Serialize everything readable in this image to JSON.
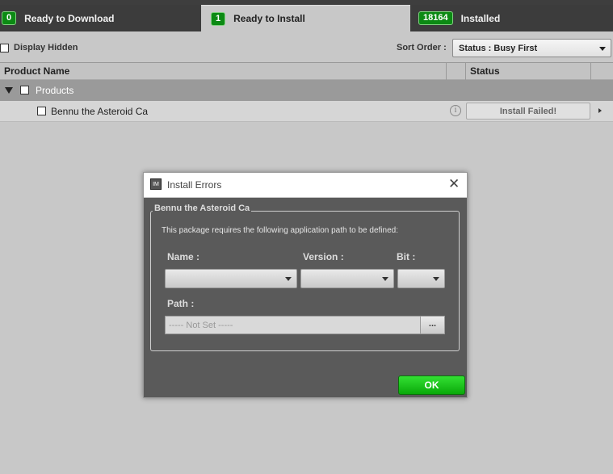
{
  "tabs": [
    {
      "count": "0",
      "label": "Ready to Download"
    },
    {
      "count": "1",
      "label": "Ready to Install"
    },
    {
      "count": "18164",
      "label": "Installed"
    }
  ],
  "toolbar": {
    "display_hidden_label": "Display Hidden",
    "sort_order_label": "Sort Order :",
    "sort_order_value": "Status : Busy First"
  },
  "grid": {
    "col_product": "Product Name",
    "col_status": "Status",
    "group_label": "Products",
    "item": {
      "name": "Bennu the Asteroid Ca",
      "status": "Install Failed!"
    }
  },
  "dialog": {
    "title": "Install Errors",
    "group_title": "Bennu the Asteroid Ca",
    "message": "This package requires the following application path to be defined:",
    "name_label": "Name :",
    "version_label": "Version :",
    "bit_label": "Bit :",
    "path_label": "Path :",
    "path_placeholder": "----- Not Set -----",
    "browse_label": "...",
    "ok_label": "OK",
    "app_icon_text": "IM"
  },
  "colors": {
    "badge": "#0c8a14",
    "ok_button": "#17c317",
    "dialog_bg": "#5a5a5a"
  }
}
